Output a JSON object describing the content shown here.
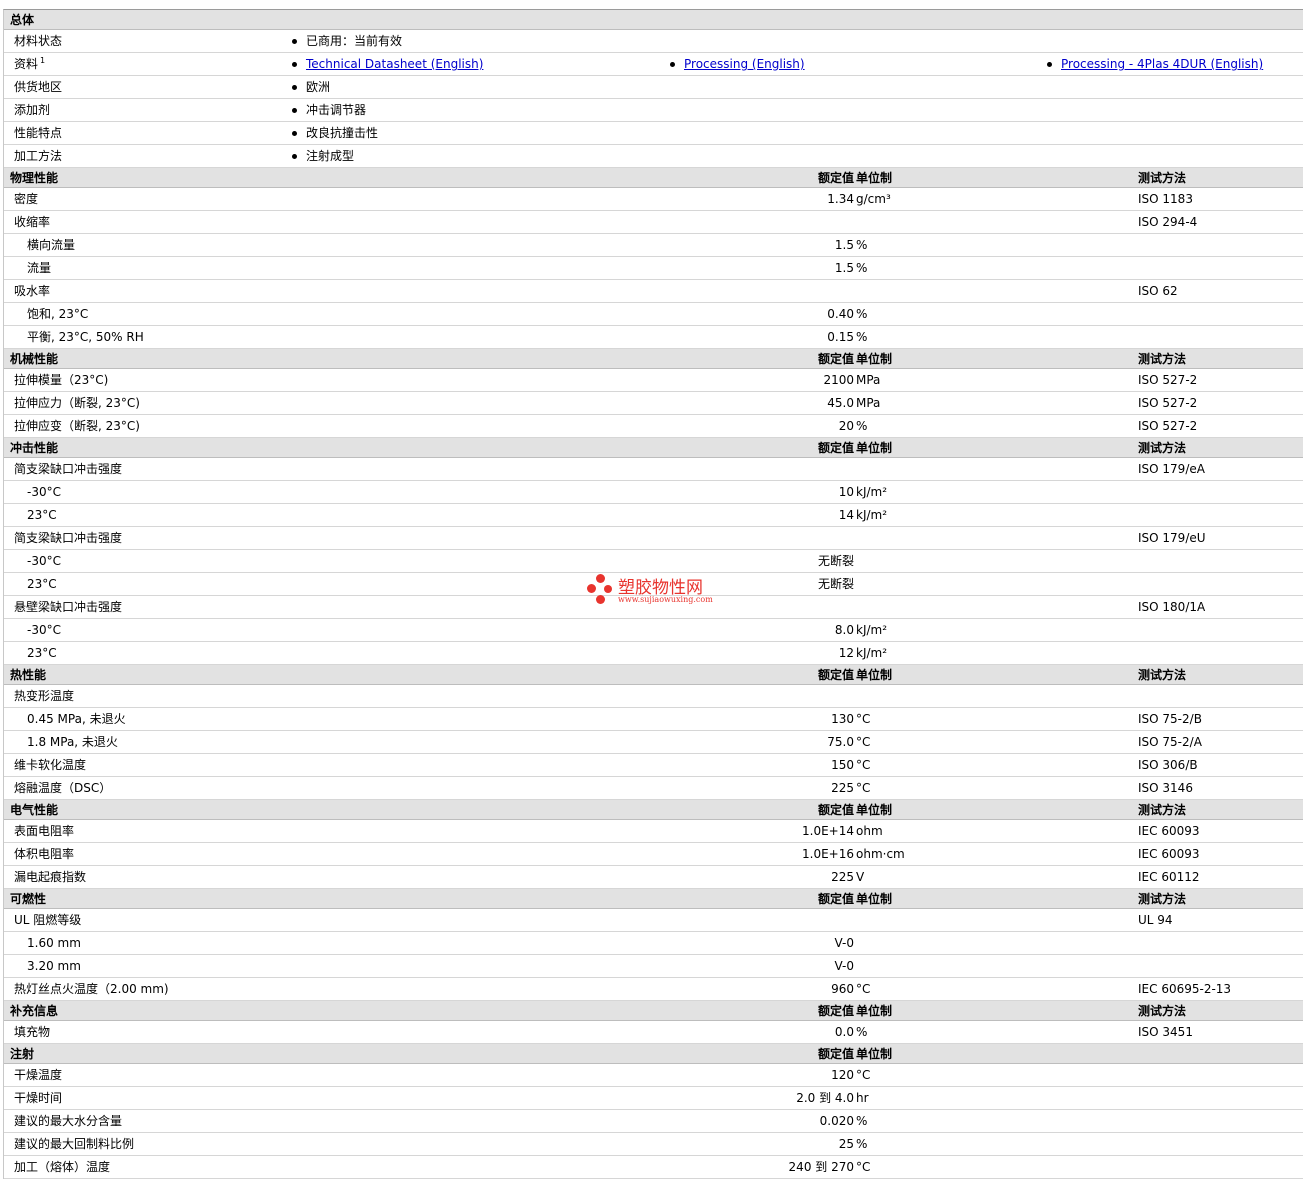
{
  "general": {
    "title": "总体",
    "material_status": {
      "label": "材料状态",
      "value": "已商用：当前有效"
    },
    "documents": {
      "label": "资料",
      "sup": "1",
      "links": [
        "Technical Datasheet (English)",
        "Processing (English)",
        "Processing - 4Plas 4DUR (English)"
      ]
    },
    "supply_region": {
      "label": "供货地区",
      "value": "欧洲"
    },
    "additive": {
      "label": "添加剂",
      "value": "冲击调节器"
    },
    "features": {
      "label": "性能特点",
      "value": "改良抗撞击性"
    },
    "processing": {
      "label": "加工方法",
      "value": "注射成型"
    }
  },
  "columns": {
    "nominal": "额定值",
    "unit": "单位制",
    "test": "测试方法"
  },
  "sections": [
    {
      "title": "物理性能",
      "rows": [
        {
          "label": "密度",
          "value": "1.34",
          "unit": "g/cm³",
          "test": "ISO 1183"
        },
        {
          "label": "收缩率",
          "value": "",
          "unit": "",
          "test": "ISO 294-4"
        },
        {
          "label": "横向流量",
          "value": "1.5",
          "unit": "%",
          "test": "",
          "sub": true
        },
        {
          "label": "流量",
          "value": "1.5",
          "unit": "%",
          "test": "",
          "sub": true
        },
        {
          "label": "吸水率",
          "value": "",
          "unit": "",
          "test": "ISO 62"
        },
        {
          "label": "饱和, 23°C",
          "value": "0.40",
          "unit": "%",
          "test": "",
          "sub": true
        },
        {
          "label": "平衡, 23°C, 50% RH",
          "value": "0.15",
          "unit": "%",
          "test": "",
          "sub": true
        }
      ]
    },
    {
      "title": "机械性能",
      "rows": [
        {
          "label": "拉伸模量（23°C)",
          "value": "2100",
          "unit": "MPa",
          "test": "ISO 527-2"
        },
        {
          "label": "拉伸应力（断裂, 23°C)",
          "value": "45.0",
          "unit": "MPa",
          "test": "ISO 527-2"
        },
        {
          "label": "拉伸应变（断裂, 23°C)",
          "value": "20",
          "unit": "%",
          "test": "ISO 527-2"
        }
      ]
    },
    {
      "title": "冲击性能",
      "rows": [
        {
          "label": "简支梁缺口冲击强度",
          "value": "",
          "unit": "",
          "test": "ISO 179/eA"
        },
        {
          "label": "-30°C",
          "value": "10",
          "unit": "kJ/m²",
          "test": "",
          "sub": true
        },
        {
          "label": "23°C",
          "value": "14",
          "unit": "kJ/m²",
          "test": "",
          "sub": true
        },
        {
          "label": "简支梁缺口冲击强度",
          "value": "",
          "unit": "",
          "test": "ISO 179/eU"
        },
        {
          "label": "-30°C",
          "value": "无断裂",
          "unit": "",
          "test": "",
          "sub": true
        },
        {
          "label": "23°C",
          "value": "无断裂",
          "unit": "",
          "test": "",
          "sub": true
        },
        {
          "label": "悬壁梁缺口冲击强度",
          "value": "",
          "unit": "",
          "test": "ISO 180/1A"
        },
        {
          "label": "-30°C",
          "value": "8.0",
          "unit": "kJ/m²",
          "test": "",
          "sub": true
        },
        {
          "label": "23°C",
          "value": "12",
          "unit": "kJ/m²",
          "test": "",
          "sub": true
        }
      ]
    },
    {
      "title": "热性能",
      "rows": [
        {
          "label": "热变形温度",
          "value": "",
          "unit": "",
          "test": ""
        },
        {
          "label": "0.45 MPa, 未退火",
          "value": "130",
          "unit": "°C",
          "test": "ISO 75-2/B",
          "sub": true
        },
        {
          "label": "1.8 MPa, 未退火",
          "value": "75.0",
          "unit": "°C",
          "test": "ISO 75-2/A",
          "sub": true
        },
        {
          "label": "维卡软化温度",
          "value": "150",
          "unit": "°C",
          "test": "ISO 306/B"
        },
        {
          "label": "熔融温度（DSC）",
          "value": "225",
          "unit": "°C",
          "test": "ISO 3146"
        }
      ]
    },
    {
      "title": "电气性能",
      "rows": [
        {
          "label": "表面电阻率",
          "value": "1.0E+14",
          "unit": "ohm",
          "test": "IEC 60093"
        },
        {
          "label": "体积电阻率",
          "value": "1.0E+16",
          "unit": "ohm·cm",
          "test": "IEC 60093"
        },
        {
          "label": "漏电起痕指数",
          "value": "225",
          "unit": "V",
          "test": "IEC 60112"
        }
      ]
    },
    {
      "title": "可燃性",
      "rows": [
        {
          "label": "UL 阻燃等级",
          "value": "",
          "unit": "",
          "test": "UL 94"
        },
        {
          "label": "1.60 mm",
          "value": "V-0",
          "unit": "",
          "test": "",
          "sub": true
        },
        {
          "label": "3.20 mm",
          "value": "V-0",
          "unit": "",
          "test": "",
          "sub": true
        },
        {
          "label": "热灯丝点火温度（2.00 mm)",
          "value": "960",
          "unit": "°C",
          "test": "IEC 60695-2-13"
        }
      ]
    },
    {
      "title": "补充信息",
      "rows": [
        {
          "label": "填充物",
          "value": "0.0",
          "unit": "%",
          "test": "ISO 3451"
        }
      ]
    },
    {
      "title": "注射",
      "testHeader": false,
      "rows": [
        {
          "label": "干燥温度",
          "value": "120",
          "unit": "°C",
          "test": ""
        },
        {
          "label": "干燥时间",
          "value": "2.0 到  4.0",
          "unit": "hr",
          "test": ""
        },
        {
          "label": "建议的最大水分含量",
          "value": "0.020",
          "unit": "%",
          "test": ""
        },
        {
          "label": "建议的最大回制料比例",
          "value": "25",
          "unit": "%",
          "test": ""
        },
        {
          "label": "加工（熔体）温度",
          "value": "240 到  270",
          "unit": "°C",
          "test": ""
        }
      ]
    }
  ],
  "watermark": {
    "brand": "塑胶物性网",
    "url": "www.sujiaowuxing.com"
  }
}
